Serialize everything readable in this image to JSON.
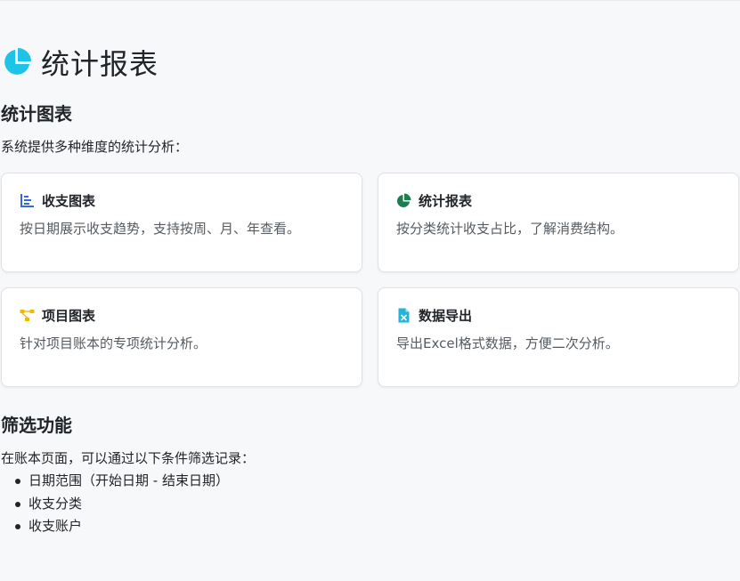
{
  "page": {
    "title": "统计报表",
    "title_icon": "pie-chart-icon",
    "accent_color": "#1ec4e8"
  },
  "charts_section": {
    "heading": "统计图表",
    "intro": "系统提供多种维度的统计分析：",
    "cards": [
      {
        "title": "收支图表",
        "icon": "bar-chart-icon",
        "icon_color": "#2f6bdc",
        "description": "按日期展示收支趋势，支持按周、月、年查看。"
      },
      {
        "title": "统计报表",
        "icon": "pie-chart-icon",
        "icon_color": "#1e7d4f",
        "description": "按分类统计收支占比，了解消费结构。"
      },
      {
        "title": "项目图表",
        "icon": "diagram-icon",
        "icon_color": "#f2b800",
        "description": "针对项目账本的专项统计分析。"
      },
      {
        "title": "数据导出",
        "icon": "excel-file-icon",
        "icon_color": "#22b5d8",
        "description": "导出Excel格式数据，方便二次分析。"
      }
    ]
  },
  "filter_section": {
    "heading": "筛选功能",
    "intro": "在账本页面，可以通过以下条件筛选记录：",
    "items": [
      "日期范围（开始日期 - 结束日期）",
      "收支分类",
      "收支账户"
    ]
  }
}
